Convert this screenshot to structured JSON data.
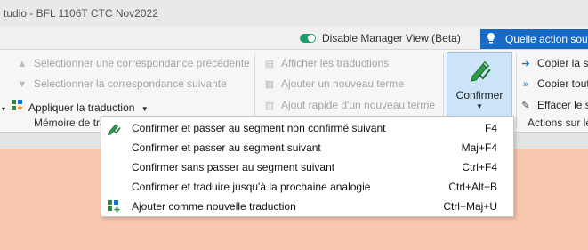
{
  "window": {
    "title": "tudio - BFL 1106T CTC Nov2022"
  },
  "topbar": {
    "manager_toggle_label": "Disable Manager View (Beta)",
    "search_label": "Quelle action sou"
  },
  "ribbon": {
    "memory_group": {
      "prev_match": "Sélectionner une correspondance précédente",
      "next_match": "Sélectionner la correspondance suivante",
      "apply_translation": "Appliquer la traduction",
      "label": "Mémoire de tra"
    },
    "term_group": {
      "show_translations": "Afficher les traductions",
      "add_term": "Ajouter un nouveau terme",
      "quick_add_term": "Ajout rapide d'un nouveau terme"
    },
    "confirm_button": {
      "label": "Confirmer"
    },
    "actions_group": {
      "copy_source": "Copier la so",
      "copy_all": "Copier tout",
      "clear": "Effacer le se",
      "label": "Actions sur le"
    }
  },
  "confirm_menu": {
    "items": [
      {
        "label": "Confirmer et passer au segment non confirmé suivant",
        "shortcut": "F4",
        "icon": "pencil-check-icon"
      },
      {
        "label": "Confirmer et passer au segment suivant",
        "shortcut": "Maj+F4",
        "icon": ""
      },
      {
        "label": "Confirmer sans passer au segment suivant",
        "shortcut": "Ctrl+F4",
        "icon": ""
      },
      {
        "label": "Confirmer et traduire jusqu'à la prochaine analogie",
        "shortcut": "Ctrl+Alt+B",
        "icon": ""
      },
      {
        "label": "Ajouter comme nouvelle traduction",
        "shortcut": "Ctrl+Maj+U",
        "icon": "add-translation-icon"
      }
    ]
  },
  "colors": {
    "accent_blue": "#1769c2",
    "toggle_green": "#1e9e6e",
    "editor_peach": "#f8c8ae",
    "confirm_highlight": "#cce4f7"
  }
}
